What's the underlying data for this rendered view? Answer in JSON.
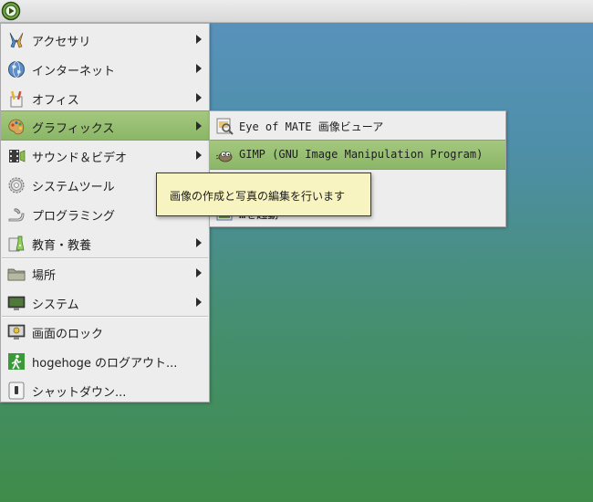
{
  "panel": {
    "menu_icon": "mate-menu-icon"
  },
  "main_menu": {
    "items": [
      {
        "label": "アクセサリ",
        "icon": "accessories-icon",
        "has_submenu": true
      },
      {
        "label": "インターネット",
        "icon": "internet-globe-icon",
        "has_submenu": true
      },
      {
        "label": "オフィス",
        "icon": "office-icon",
        "has_submenu": true
      },
      {
        "label": "グラフィックス",
        "icon": "graphics-palette-icon",
        "has_submenu": true,
        "active": true
      },
      {
        "label": "サウンド＆ビデオ",
        "icon": "sound-video-icon",
        "has_submenu": true
      },
      {
        "label": "システムツール",
        "icon": "system-tools-gear-icon",
        "has_submenu": true
      },
      {
        "label": "プログラミング",
        "icon": "programming-icon",
        "has_submenu": true
      },
      {
        "label": "教育・教養",
        "icon": "education-icon",
        "has_submenu": true
      },
      {
        "label": "場所",
        "icon": "folder-icon",
        "has_submenu": true
      },
      {
        "label": "システム",
        "icon": "monitor-icon",
        "has_submenu": true
      },
      {
        "label": "画面のロック",
        "icon": "lock-screen-icon",
        "has_submenu": false
      },
      {
        "label": "hogehoge のログアウト...",
        "icon": "logout-icon",
        "has_submenu": false
      },
      {
        "label": "シャットダウン...",
        "icon": "shutdown-icon",
        "has_submenu": false
      }
    ]
  },
  "graphics_submenu": {
    "items": [
      {
        "label": "Eye of MATE 画像ビューア",
        "icon": "image-viewer-icon"
      },
      {
        "label": "GIMP (GNU Image Manipulation Program)",
        "icon": "gimp-icon",
        "active": true
      },
      {
        "label": "",
        "icon": "",
        "hidden_by_tooltip": true
      },
      {
        "label": "…を起動",
        "icon": "screenshot-icon",
        "partially_hidden": true
      }
    ]
  },
  "tooltip": {
    "text": "画像の作成と写真の編集を行います"
  },
  "colors": {
    "highlight": "#96bd70",
    "menu_bg": "#ededed",
    "tooltip_bg": "#f7f4c2"
  }
}
